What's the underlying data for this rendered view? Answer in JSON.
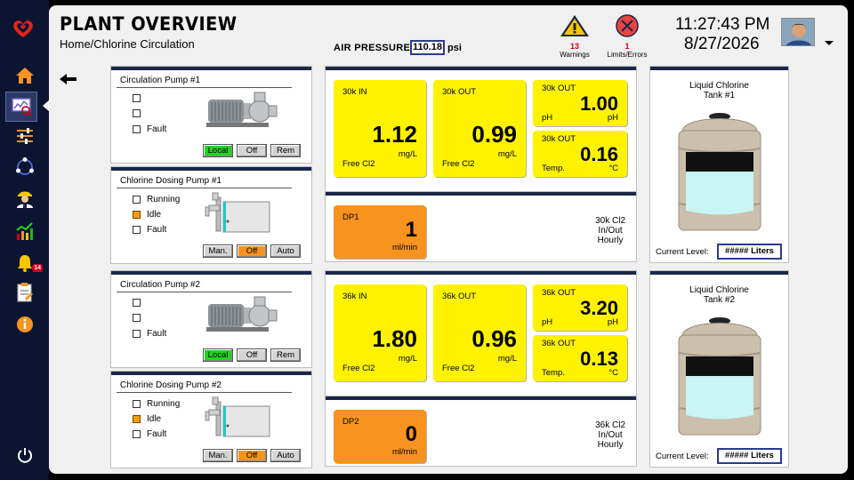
{
  "header": {
    "title": "PLANT OVERVIEW",
    "breadcrumb": "Home/Chlorine Circulation",
    "air_pressure_label": "AIR PRESSURE:",
    "air_pressure_value": "110.18",
    "air_pressure_unit": "psi",
    "warnings_count": "13",
    "warnings_label": "Warnings",
    "errors_count": "1",
    "errors_label": "Limits/Errors",
    "time": "11:27:43 PM",
    "date": "8/27/2026"
  },
  "sidebar": {
    "items": [
      "home-icon",
      "dashboard-icon",
      "sliders-icon",
      "cycle-icon",
      "operator-icon",
      "trend-icon",
      "alarm-bell-icon",
      "report-icon",
      "info-icon",
      "power-icon"
    ],
    "alarm_badge": "14"
  },
  "colors": {
    "tile_yellow": "#fff200",
    "tile_orange": "#f7931e",
    "status_green": "#22d322",
    "accent_navy": "#1c2748"
  },
  "pumps": [
    {
      "title": "Circulation Pump #1",
      "rows": [
        "",
        "",
        "Fault"
      ],
      "active_row": -1,
      "buttons": [
        "Local",
        "Off",
        "Rem"
      ],
      "active_button": "Local"
    },
    {
      "title": "Chlorine Dosing Pump #1",
      "rows": [
        "Running",
        "Idle",
        "Fault"
      ],
      "active_row": 1,
      "buttons": [
        "Man.",
        "Off",
        "Auto"
      ],
      "active_button": "Off"
    },
    {
      "title": "Circulation Pump #2",
      "rows": [
        "",
        "",
        "Fault"
      ],
      "active_row": -1,
      "buttons": [
        "Local",
        "Off",
        "Rem"
      ],
      "active_button": "Local"
    },
    {
      "title": "Chlorine Dosing Pump #2",
      "rows": [
        "Running",
        "Idle",
        "Fault"
      ],
      "active_row": 1,
      "buttons": [
        "Man.",
        "Off",
        "Auto"
      ],
      "active_button": "Off"
    }
  ],
  "groups": [
    {
      "in": {
        "label": "30k IN",
        "value": "1.12",
        "unit": "mg/L",
        "sub": "Free Cl2"
      },
      "out": {
        "label": "30k OUT",
        "value": "0.99",
        "unit": "mg/L",
        "sub": "Free Cl2"
      },
      "ph": {
        "label": "30k OUT",
        "value": "1.00",
        "unit": "pH",
        "sub": "pH"
      },
      "temp": {
        "label": "30k OUT",
        "value": "0.16",
        "unit": "°C",
        "sub": "Temp."
      },
      "dp": {
        "label": "DP1",
        "value": "1",
        "unit": "ml/min",
        "desc": [
          "30k Cl2",
          "In/Out",
          "Hourly"
        ]
      }
    },
    {
      "in": {
        "label": "36k IN",
        "value": "1.80",
        "unit": "mg/L",
        "sub": "Free Cl2"
      },
      "out": {
        "label": "36k OUT",
        "value": "0.96",
        "unit": "mg/L",
        "sub": "Free Cl2"
      },
      "ph": {
        "label": "36k OUT",
        "value": "3.20",
        "unit": "pH",
        "sub": "pH"
      },
      "temp": {
        "label": "36k OUT",
        "value": "0.13",
        "unit": "°C",
        "sub": "Temp."
      },
      "dp": {
        "label": "DP2",
        "value": "0",
        "unit": "ml/min",
        "desc": [
          "36k Cl2",
          "In/Out",
          "Hourly"
        ]
      }
    }
  ],
  "tanks": [
    {
      "title": [
        "Liquid Chlorine",
        "Tank #1"
      ],
      "level_label": "Current Level:",
      "level_value": "##### Liters"
    },
    {
      "title": [
        "Liquid Chlorine",
        "Tank #2"
      ],
      "level_label": "Current Level:",
      "level_value": "##### Liters"
    }
  ]
}
